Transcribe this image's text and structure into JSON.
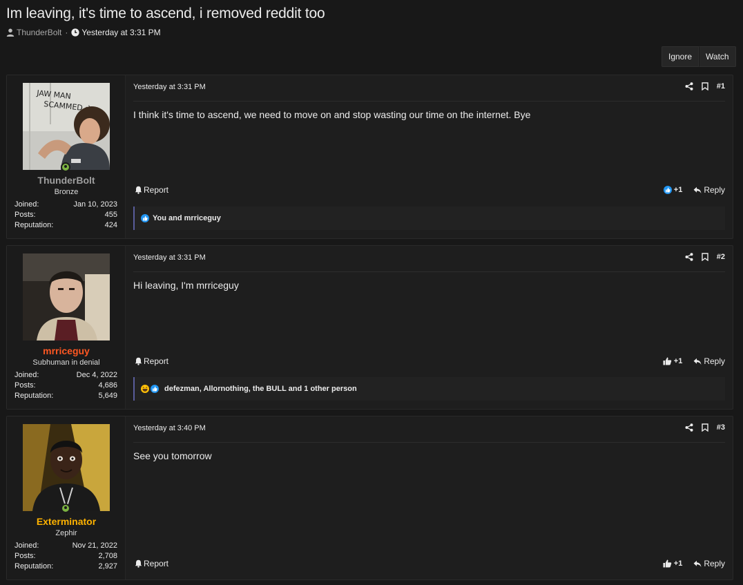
{
  "thread": {
    "title": "Im leaving, it's time to ascend, i removed reddit too",
    "author": "ThunderBolt",
    "separator": "·",
    "date": "Yesterday at 3:31 PM"
  },
  "buttons": {
    "ignore": "Ignore",
    "watch": "Watch"
  },
  "posts": [
    {
      "username": "ThunderBolt",
      "username_color": "#9e9e9e",
      "user_title": "Bronze",
      "online": true,
      "avatar_text": "JAW MAN SCAMMED :)",
      "stats": [
        {
          "k": "Joined:",
          "v": "Jan 10, 2023"
        },
        {
          "k": "Posts:",
          "v": "455"
        },
        {
          "k": "Reputation:",
          "v": "424"
        }
      ],
      "date": "Yesterday at 3:31 PM",
      "number": "#1",
      "body": "I think it's time to ascend, we need to move on and stop wasting our time on the internet. Bye",
      "report": "Report",
      "like": "+1",
      "reply": "Reply",
      "reactions": "You and mrriceguy"
    },
    {
      "username": "mrriceguy",
      "username_color": "#ff5722",
      "user_title": "Subhuman in denial",
      "online": false,
      "stats": [
        {
          "k": "Joined:",
          "v": "Dec 4, 2022"
        },
        {
          "k": "Posts:",
          "v": "4,686"
        },
        {
          "k": "Reputation:",
          "v": "5,649"
        }
      ],
      "date": "Yesterday at 3:31 PM",
      "number": "#2",
      "body": "Hi leaving, I'm mrriceguy",
      "report": "Report",
      "like": "+1",
      "reply": "Reply",
      "reactions": "defezman, Allornothing, the BULL and 1 other person"
    },
    {
      "username": "Exterminator",
      "username_color": "#ffb300",
      "user_title": "Zephir",
      "online": true,
      "stats": [
        {
          "k": "Joined:",
          "v": "Nov 21, 2022"
        },
        {
          "k": "Posts:",
          "v": "2,708"
        },
        {
          "k": "Reputation:",
          "v": "2,927"
        }
      ],
      "date": "Yesterday at 3:40 PM",
      "number": "#3",
      "body": "See you tomorrow",
      "report": "Report",
      "like": "+1",
      "reply": "Reply"
    }
  ],
  "icons": {
    "share": "share-icon",
    "bookmark": "bookmark-icon",
    "bell": "bell-icon",
    "like": "thumbs-up-icon",
    "reply": "reply-arrow-icon"
  },
  "colors": {
    "accent_bar": "#5a5d9c",
    "online": "#7cb342",
    "like_blue": "#2196f3"
  }
}
